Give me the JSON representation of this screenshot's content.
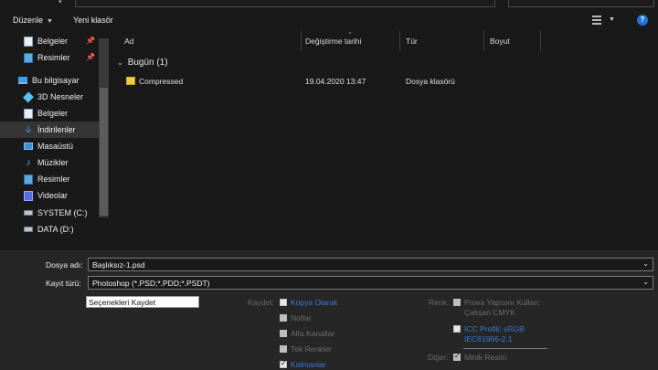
{
  "toolbar": {
    "organize_label": "Düzenle",
    "new_folder_label": "Yeni klasör",
    "help_label": "?"
  },
  "nav": {
    "items": [
      {
        "label": "Belgeler",
        "icon": "document-icon",
        "pinned": true
      },
      {
        "label": "Resimler",
        "icon": "pictures-icon",
        "pinned": true
      },
      {
        "label": "Bu bilgisayar",
        "icon": "computer-icon",
        "pinned": false
      },
      {
        "label": "3D Nesneler",
        "icon": "cube-icon",
        "pinned": false
      },
      {
        "label": "Belgeler",
        "icon": "document-icon",
        "pinned": false
      },
      {
        "label": "İndirilenler",
        "icon": "download-icon",
        "pinned": false,
        "selected": true
      },
      {
        "label": "Masaüstü",
        "icon": "desktop-icon",
        "pinned": false
      },
      {
        "label": "Müzikler",
        "icon": "music-icon",
        "pinned": false
      },
      {
        "label": "Resimler",
        "icon": "pictures-icon",
        "pinned": false
      },
      {
        "label": "Videolar",
        "icon": "video-icon",
        "pinned": false
      },
      {
        "label": "SYSTEM (C:)",
        "icon": "drive-icon",
        "pinned": false
      },
      {
        "label": "DATA (D:)",
        "icon": "drive-icon",
        "pinned": false
      }
    ]
  },
  "list": {
    "columns": {
      "name": "Ad",
      "date": "Değiştirme tarihi",
      "type": "Tür",
      "size": "Boyut"
    },
    "group_label": "Bugün (1)",
    "rows": [
      {
        "name": "Compressed",
        "date": "19.04.2020 13:47",
        "type": "Dosya klasörü",
        "size": ""
      }
    ]
  },
  "save": {
    "filename_label": "Dosya adı:",
    "filename_value": "Başlıksız-1.psd",
    "type_label": "Kayıt türü:",
    "type_value": "Photoshop (*.PSD;*.PDD;*.PSDT)",
    "options_button": "Seçenekleri Kaydet",
    "save_group_label": "Kaydet:",
    "save_options": [
      {
        "label": "Kopya Olarak",
        "checked": false,
        "enabled": true
      },
      {
        "label": "Notlar",
        "checked": false,
        "enabled": false
      },
      {
        "label": "Alfa Kanallar",
        "checked": false,
        "enabled": false
      },
      {
        "label": "Tek Renkler",
        "checked": false,
        "enabled": false
      },
      {
        "label": "Katmanlar",
        "checked": true,
        "enabled": true
      }
    ],
    "color_group_label": "Renk:",
    "proof_label_1": "Prova Yapısını Kullan:",
    "proof_label_2": "Çalışan CMYK",
    "icc_label_1": "ICC Profili: sRGB",
    "icc_label_2": "IEC61966-2.1",
    "other_group_label": "Diğer:",
    "thumbnail_label": "Minik Resim"
  },
  "colors": {
    "accent": "#3b78d8",
    "background": "#191919",
    "panel": "#262626"
  }
}
